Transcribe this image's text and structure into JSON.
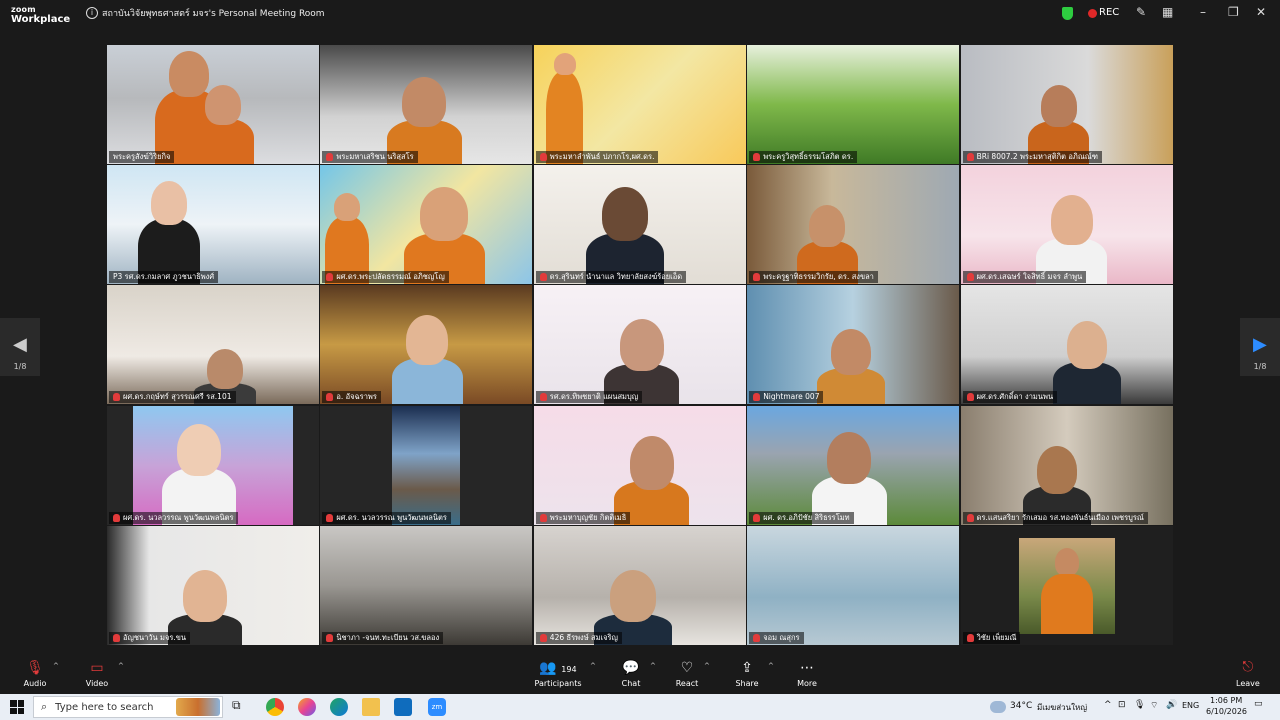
{
  "window": {
    "logo_line1": "zoom",
    "logo_line2": "Workplace",
    "title": "สถาบันวิจัยพุทธศาสตร์ มจร's Personal Meeting Room",
    "rec": "REC"
  },
  "gallery": {
    "page_left": "1/8",
    "page_right": "1/8",
    "tiles": [
      {
        "name": "พระครูสังฆ์วิริยกิจ",
        "muted": false,
        "active": true
      },
      {
        "name": "พระมหาเสริชน นริสฺสโร",
        "muted": true
      },
      {
        "name": "พระมหาลำพันธ์ ปภากโร,ผศ.ดร.",
        "muted": true
      },
      {
        "name": "พระครูวิสุทธิ์ธรรมโสภิต ดร.",
        "muted": true
      },
      {
        "name": "BRi 8007.2 พระมหาสุติกิต อภิณณ์ฑ",
        "muted": true
      },
      {
        "name": "P3 รศ.ดร.กมลาศ ภูวชนาธิพงศ์",
        "muted": false
      },
      {
        "name": "ผศ.ดร.พระปลัดธรรมณ์ อภิชญโญ",
        "muted": true
      },
      {
        "name": "ดร.สุรินทร์ นำนาแล วิทยาลัยสงฆ์ร้อยเอ็ด",
        "muted": true
      },
      {
        "name": "พระครูฐาทิธรรมวิกรัย, ดร. สงขลา",
        "muted": true
      },
      {
        "name": "ผศ.ดร.เสฉษร์ ใจสิทธิ์ มจร ลำพูน",
        "muted": true
      },
      {
        "name": "ผศ.ดร.กฤษ์ทร์ สุวรรณศรี รส.101",
        "muted": true
      },
      {
        "name": "อ. อัจฉราพร",
        "muted": true
      },
      {
        "name": "รศ.ดร.ทิพชยาติ แผนสมบุญ",
        "muted": true
      },
      {
        "name": "Nightmare 007",
        "muted": true
      },
      {
        "name": "ผศ.ดร.ศักดิ์ดา งามนพน",
        "muted": true
      },
      {
        "name": "ผศ.ดร. นวลวรรณ พูนวัฒนพลนิตร",
        "muted": true
      },
      {
        "name": "ผศ.ดร. นวลวรรณ พูนวัฒนพลนิตร",
        "muted": true
      },
      {
        "name": "พระมหาบุญชัย กิตติเมธิ",
        "muted": true
      },
      {
        "name": "ผศ. ดร.อภิปัชัย สิริธรรโมท",
        "muted": true
      },
      {
        "name": "ดร.แสนสริยา รักเสมอ รส.ทองพันธ์นเมือง เพชรบูรณ์",
        "muted": true
      },
      {
        "name": "อัญชนาวัน มจร.ขน",
        "muted": true
      },
      {
        "name": "นิชาภา -จนท.ทะเบียน วส.ขลอง",
        "muted": true
      },
      {
        "name": "426 ธีรพงษ์ สมเจริญ",
        "muted": true
      },
      {
        "name": "จอม ณสุกร",
        "muted": true
      },
      {
        "name": "วิชัย เพ็ยมณี",
        "muted": true
      }
    ]
  },
  "controls": {
    "audio": "Audio",
    "video": "Video",
    "participants": "Participants",
    "participants_count": "194",
    "chat": "Chat",
    "react": "React",
    "share": "Share",
    "more": "More",
    "leave": "Leave"
  },
  "taskbar": {
    "search_placeholder": "Type here to search",
    "weather": "34°C",
    "weather_desc": "มีเมฆส่วนใหญ่",
    "lang": "ENG",
    "time": "1:06 PM",
    "date": "6/10/2026"
  }
}
